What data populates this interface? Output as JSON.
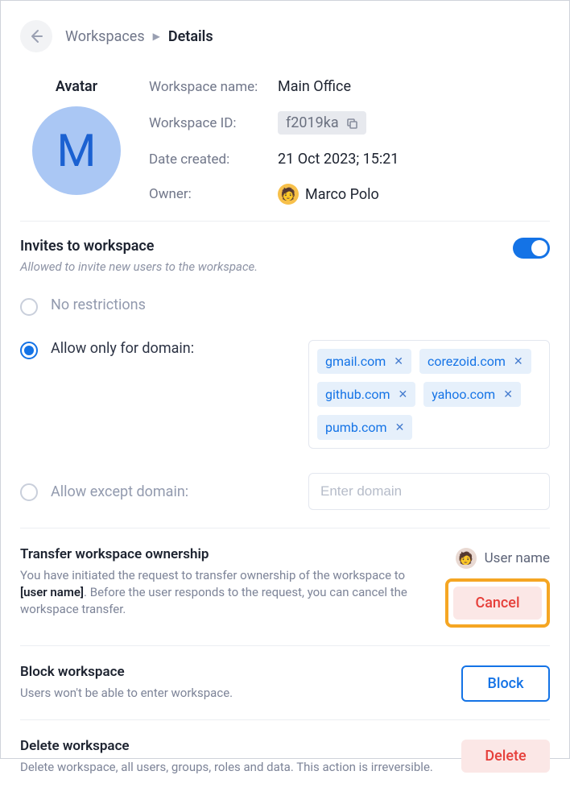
{
  "breadcrumb": {
    "link": "Workspaces",
    "current": "Details"
  },
  "avatar": {
    "label": "Avatar",
    "letter": "M"
  },
  "fields": {
    "name_label": "Workspace name:",
    "name_value": "Main Office",
    "id_label": "Workspace ID:",
    "id_value": "f2019ka",
    "date_label": "Date created:",
    "date_value": "21 Oct 2023; 15:21",
    "owner_label": "Owner:",
    "owner_value": "Marco Polo"
  },
  "invites": {
    "title": "Invites to workspace",
    "desc": "Allowed to invite new users to the workspace.",
    "radio_none": "No restrictions",
    "radio_allow": "Allow only for domain:",
    "radio_except": "Allow except domain:",
    "domain_placeholder": "Enter domain",
    "tags": [
      "gmail.com",
      "corezoid.com",
      "github.com",
      "yahoo.com",
      "pumb.com"
    ]
  },
  "transfer": {
    "title": "Transfer workspace ownership",
    "desc_a": "You have initiated the request to transfer ownership of the workspace to ",
    "desc_b": "[user name]",
    "desc_c": ". Before the user responds to the request, you can cancel the workspace transfer.",
    "user": "User name",
    "cancel": "Cancel"
  },
  "block": {
    "title": "Block workspace",
    "desc": "Users won't be able to enter workspace.",
    "button": "Block"
  },
  "delete": {
    "title": "Delete workspace",
    "desc": "Delete workspace, all users, groups, roles and data. This action is irreversible.",
    "button": "Delete"
  }
}
